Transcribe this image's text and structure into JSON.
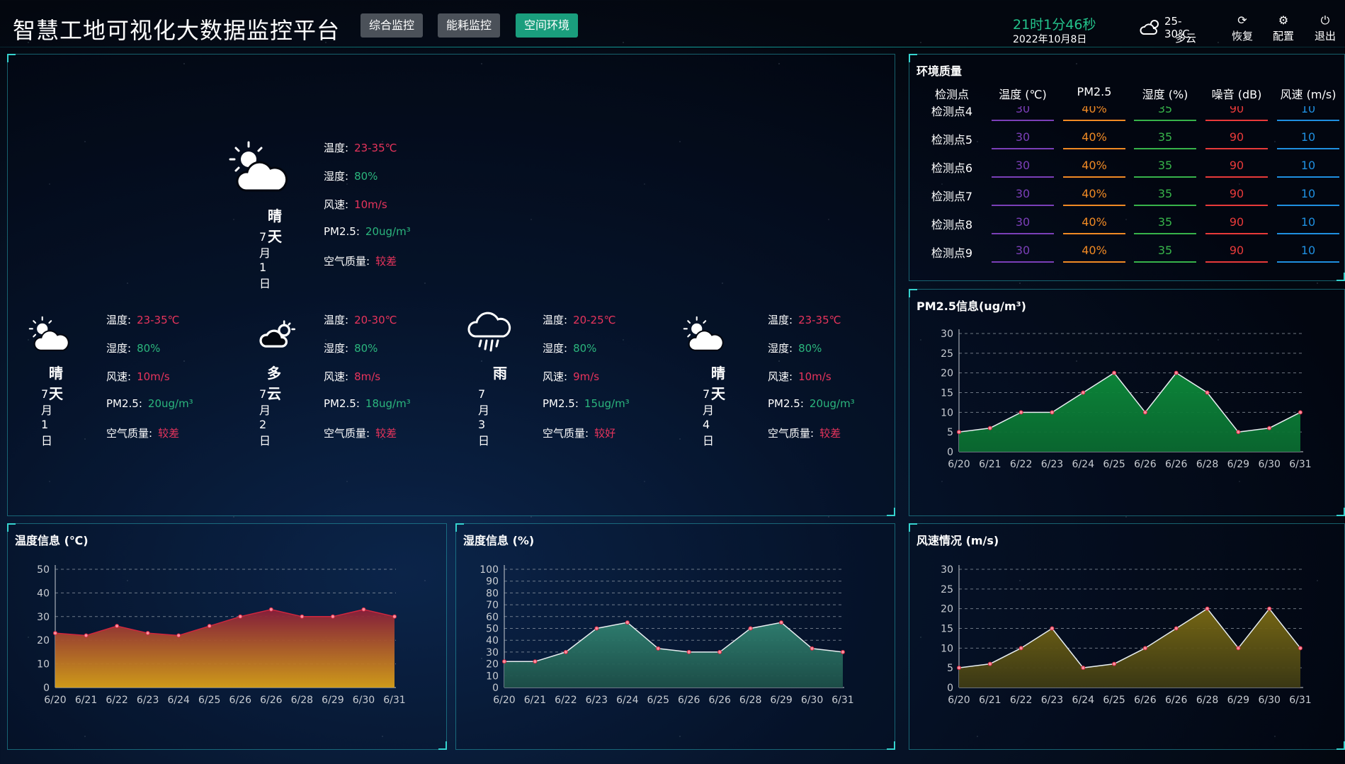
{
  "header": {
    "title": "智慧工地可视化大数据监控平台",
    "tabs": [
      {
        "label": "综合监控",
        "active": false
      },
      {
        "label": "能耗监控",
        "active": false
      },
      {
        "label": "空间环境",
        "active": true
      }
    ],
    "clock": "21时1分46秒",
    "date": "2022年10月8日",
    "weather": {
      "temp": "25-30℃",
      "desc": "多云",
      "icon": "cloud-sun-icon"
    },
    "buttons": [
      {
        "label": "恢复",
        "icon": "refresh-icon"
      },
      {
        "label": "配置",
        "icon": "gear-icon"
      },
      {
        "label": "退出",
        "icon": "power-icon"
      }
    ]
  },
  "forecast": {
    "labels": {
      "temp": "温度:",
      "humidity": "湿度:",
      "wind": "风速:",
      "pm25": "PM2.5:",
      "aq": "空气质量:"
    },
    "main": {
      "weather": "晴天",
      "date": "7月1日",
      "temp": "23-35℃",
      "humidity": "80%",
      "wind": "10m/s",
      "pm25": "20ug/m³",
      "aq": "较差",
      "icon": "sun-cloud-icon"
    },
    "days": [
      {
        "weather": "晴天",
        "date": "7月1日",
        "temp": "23-35℃",
        "humidity": "80%",
        "wind": "10m/s",
        "pm25": "20ug/m³",
        "aq": "较差",
        "icon": "sun-cloud-icon"
      },
      {
        "weather": "多云",
        "date": "7月2日",
        "temp": "20-30℃",
        "humidity": "80%",
        "wind": "8m/s",
        "pm25": "18ug/m³",
        "aq": "较差",
        "icon": "cloud-sun-icon"
      },
      {
        "weather": "雨",
        "date": "7月3日",
        "temp": "20-25℃",
        "humidity": "80%",
        "wind": "9m/s",
        "pm25": "15ug/m³",
        "aq": "较好",
        "icon": "rain-icon"
      },
      {
        "weather": "晴天",
        "date": "7月4日",
        "temp": "23-35℃",
        "humidity": "80%",
        "wind": "10m/s",
        "pm25": "20ug/m³",
        "aq": "较差",
        "icon": "sun-cloud-icon"
      }
    ]
  },
  "env_quality": {
    "title": "环境质量",
    "columns": [
      "检测点",
      "温度 (℃)",
      "PM2.5",
      "湿度 (%)",
      "噪音 (dB)",
      "风速 (m/s)"
    ],
    "column_colors": [
      "#ffffff",
      "#7b3fb8",
      "#f08a24",
      "#37b34a",
      "#e83a3a",
      "#1f8fe0"
    ],
    "partial_row": [
      "检测点4",
      "30",
      "40%",
      "35",
      "90",
      "10"
    ],
    "rows": [
      [
        "检测点5",
        "30",
        "40%",
        "35",
        "90",
        "10"
      ],
      [
        "检测点6",
        "30",
        "40%",
        "35",
        "90",
        "10"
      ],
      [
        "检测点7",
        "30",
        "40%",
        "35",
        "90",
        "10"
      ],
      [
        "检测点8",
        "30",
        "40%",
        "35",
        "90",
        "10"
      ],
      [
        "检测点9",
        "30",
        "40%",
        "35",
        "90",
        "10"
      ]
    ]
  },
  "chart_titles": {
    "pm25": "PM2.5信息(ug/m³)",
    "temp": "温度信息 (℃)",
    "humidity": "湿度信息 (%)",
    "wind": "风速情况 (m/s)"
  },
  "chart_data": [
    {
      "id": "pm25",
      "type": "area",
      "title": "PM2.5信息(ug/m³)",
      "categories": [
        "6/20",
        "6/21",
        "6/22",
        "6/23",
        "6/24",
        "6/25",
        "6/26",
        "6/26",
        "6/28",
        "6/29",
        "6/30",
        "6/31"
      ],
      "values": [
        5,
        6,
        10,
        10,
        15,
        20,
        10,
        20,
        15,
        5,
        6,
        10
      ],
      "ylim": [
        0,
        30
      ],
      "yticks": [
        0,
        5,
        10,
        15,
        20,
        25,
        30
      ],
      "color": "#0c8a3a",
      "grid": true
    },
    {
      "id": "temp",
      "type": "area",
      "title": "温度信息 (℃)",
      "categories": [
        "6/20",
        "6/21",
        "6/22",
        "6/23",
        "6/24",
        "6/25",
        "6/26",
        "6/26",
        "6/28",
        "6/29",
        "6/30",
        "6/31"
      ],
      "values": [
        23,
        22,
        26,
        23,
        22,
        26,
        30,
        33,
        30,
        30,
        33,
        30
      ],
      "ylim": [
        0,
        50
      ],
      "yticks": [
        0,
        10,
        20,
        30,
        40,
        50
      ],
      "color": "#b0233b",
      "grid": true
    },
    {
      "id": "humidity",
      "type": "area",
      "title": "湿度信息 (%)",
      "categories": [
        "6/20",
        "6/21",
        "6/22",
        "6/23",
        "6/24",
        "6/25",
        "6/26",
        "6/26",
        "6/28",
        "6/29",
        "6/30",
        "6/31"
      ],
      "values": [
        22,
        22,
        30,
        50,
        55,
        33,
        30,
        30,
        50,
        55,
        33,
        30
      ],
      "ylim": [
        0,
        100
      ],
      "yticks": [
        0,
        10,
        20,
        30,
        40,
        50,
        60,
        70,
        80,
        90,
        100
      ],
      "color": "#2c7a6b",
      "grid": true
    },
    {
      "id": "wind",
      "type": "area",
      "title": "风速情况 (m/s)",
      "categories": [
        "6/20",
        "6/21",
        "6/22",
        "6/23",
        "6/24",
        "6/25",
        "6/26",
        "6/26",
        "6/28",
        "6/29",
        "6/30",
        "6/31"
      ],
      "values": [
        5,
        6,
        10,
        15,
        5,
        6,
        10,
        15,
        20,
        10,
        20,
        10
      ],
      "ylim": [
        0,
        30
      ],
      "yticks": [
        0,
        5,
        10,
        15,
        20,
        25,
        30
      ],
      "color": "#6b5a12",
      "grid": true
    }
  ]
}
